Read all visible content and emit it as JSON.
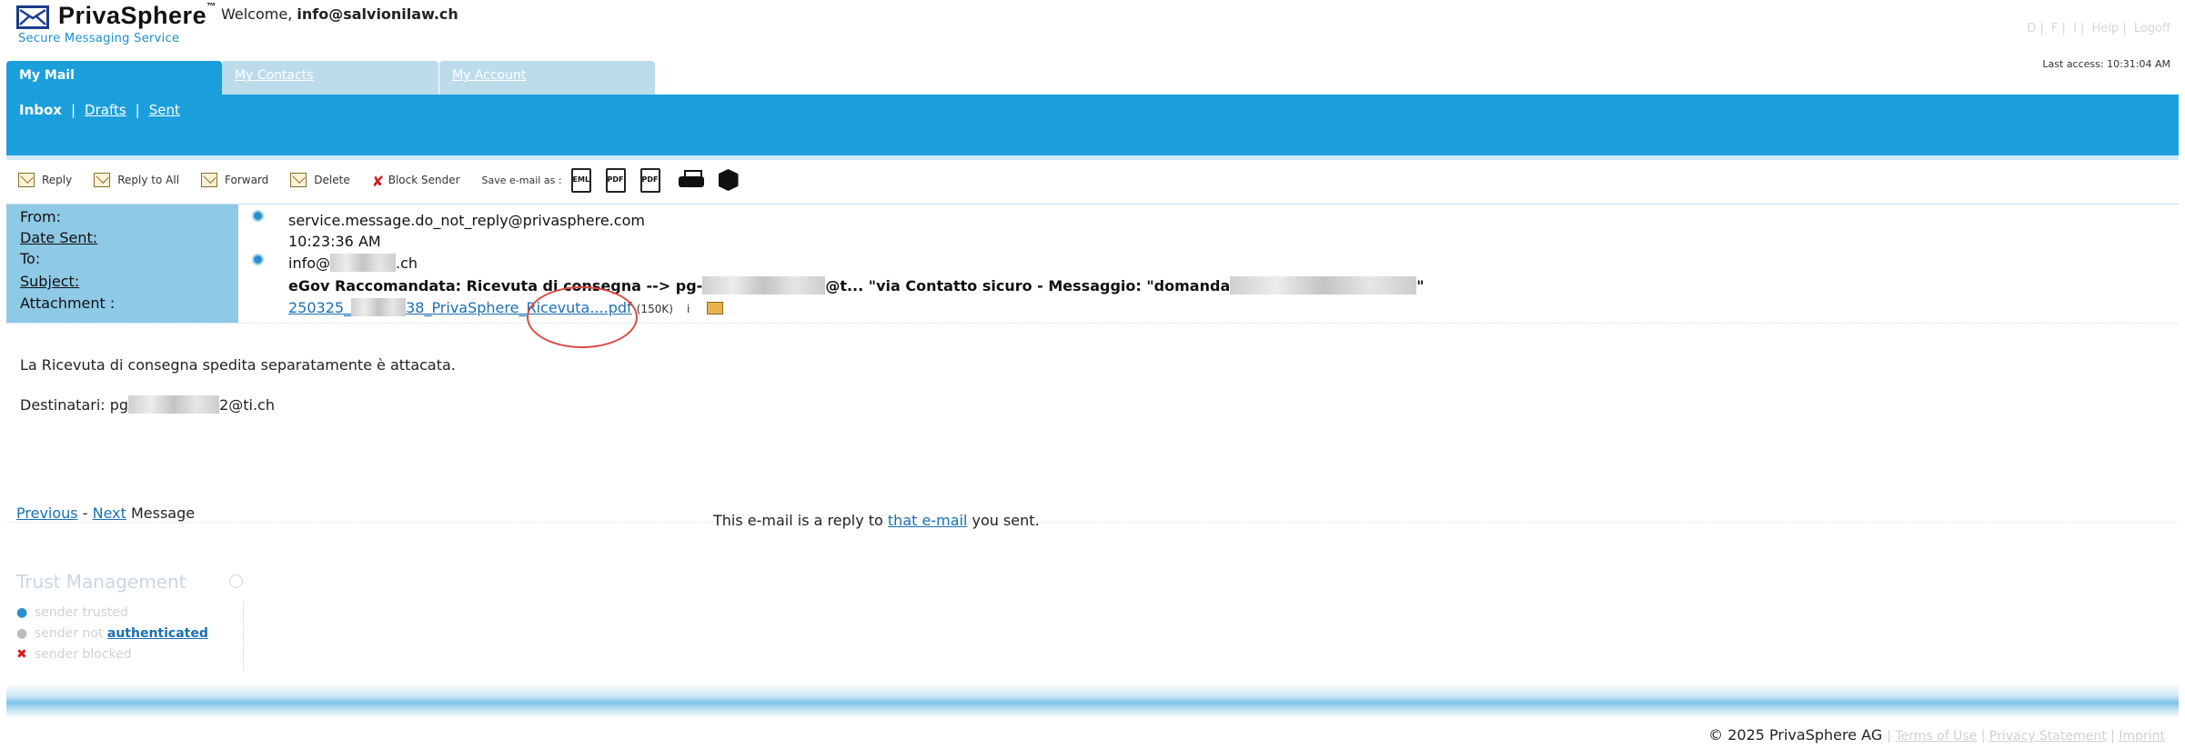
{
  "brand": {
    "name": "PrivaSphere",
    "tm": "™",
    "tagline": "Secure Messaging Service"
  },
  "header": {
    "welcome_prefix": "Welcome,",
    "user": "info@salvionilaw.ch",
    "links": [
      "D",
      "F",
      "I",
      "Help",
      "Logoff"
    ],
    "last_access": "Last access: 10:31:04 AM"
  },
  "tabs": [
    {
      "label": "My Mail",
      "active": true
    },
    {
      "label": "My Contacts",
      "active": false
    },
    {
      "label": "My Account",
      "active": false
    }
  ],
  "subnav": {
    "current": "Inbox",
    "items": [
      "Drafts",
      "Sent"
    ]
  },
  "toolbar": {
    "reply": "Reply",
    "reply_all": "Reply to All",
    "forward": "Forward",
    "delete": "Delete",
    "block_sender": "Block Sender",
    "save_as": "Save e-mail as :",
    "formats": [
      "EML",
      "PDF",
      "PDF"
    ]
  },
  "message": {
    "labels": {
      "from": "From:",
      "date_sent": "Date Sent:",
      "to": "To:",
      "subject": "Subject:",
      "attachment": "Attachment :"
    },
    "from": "service.message.do_not_reply@privasphere.com",
    "date_sent": "10:23:36 AM",
    "to_prefix": "info@",
    "to_suffix": ".ch",
    "subject_a": "eGov Raccomandata: Ricevuta di consegna --> pg-",
    "subject_b": "@t... \"via Contatto sicuro - Messaggio: \"domanda",
    "subject_c": "\"",
    "attachment_a": "250325_",
    "attachment_b": "38_PrivaSphere_Ricevuta....pdf",
    "attachment_size": "(150K)",
    "attachment_info": "i",
    "body_line1": "La Ricevuta di consegna spedita separatamente è attacata.",
    "body_line2_prefix": "Destinatari: pg",
    "body_line2_suffix": "2@ti.ch"
  },
  "pager": {
    "previous": "Previous",
    "dash": "-",
    "next": "Next",
    "suffix": "Message"
  },
  "reply_note": {
    "prefix": "This e-mail is a reply to",
    "link": "that e-mail",
    "suffix": "you sent."
  },
  "trust": {
    "title": "Trust Management",
    "trusted": "sender trusted",
    "not_auth_prefix": "sender not",
    "not_auth_link": "authenticated",
    "blocked": "sender blocked"
  },
  "footer": {
    "copyright": "© 2025 PrivaSphere AG",
    "links": [
      "Terms of Use",
      "Privacy Statement",
      "Imprint"
    ]
  },
  "colors": {
    "accent": "#1b9fdc",
    "label_bg": "#8ec9e6",
    "link": "#1b6fb3",
    "annotation": "#d94b45"
  }
}
